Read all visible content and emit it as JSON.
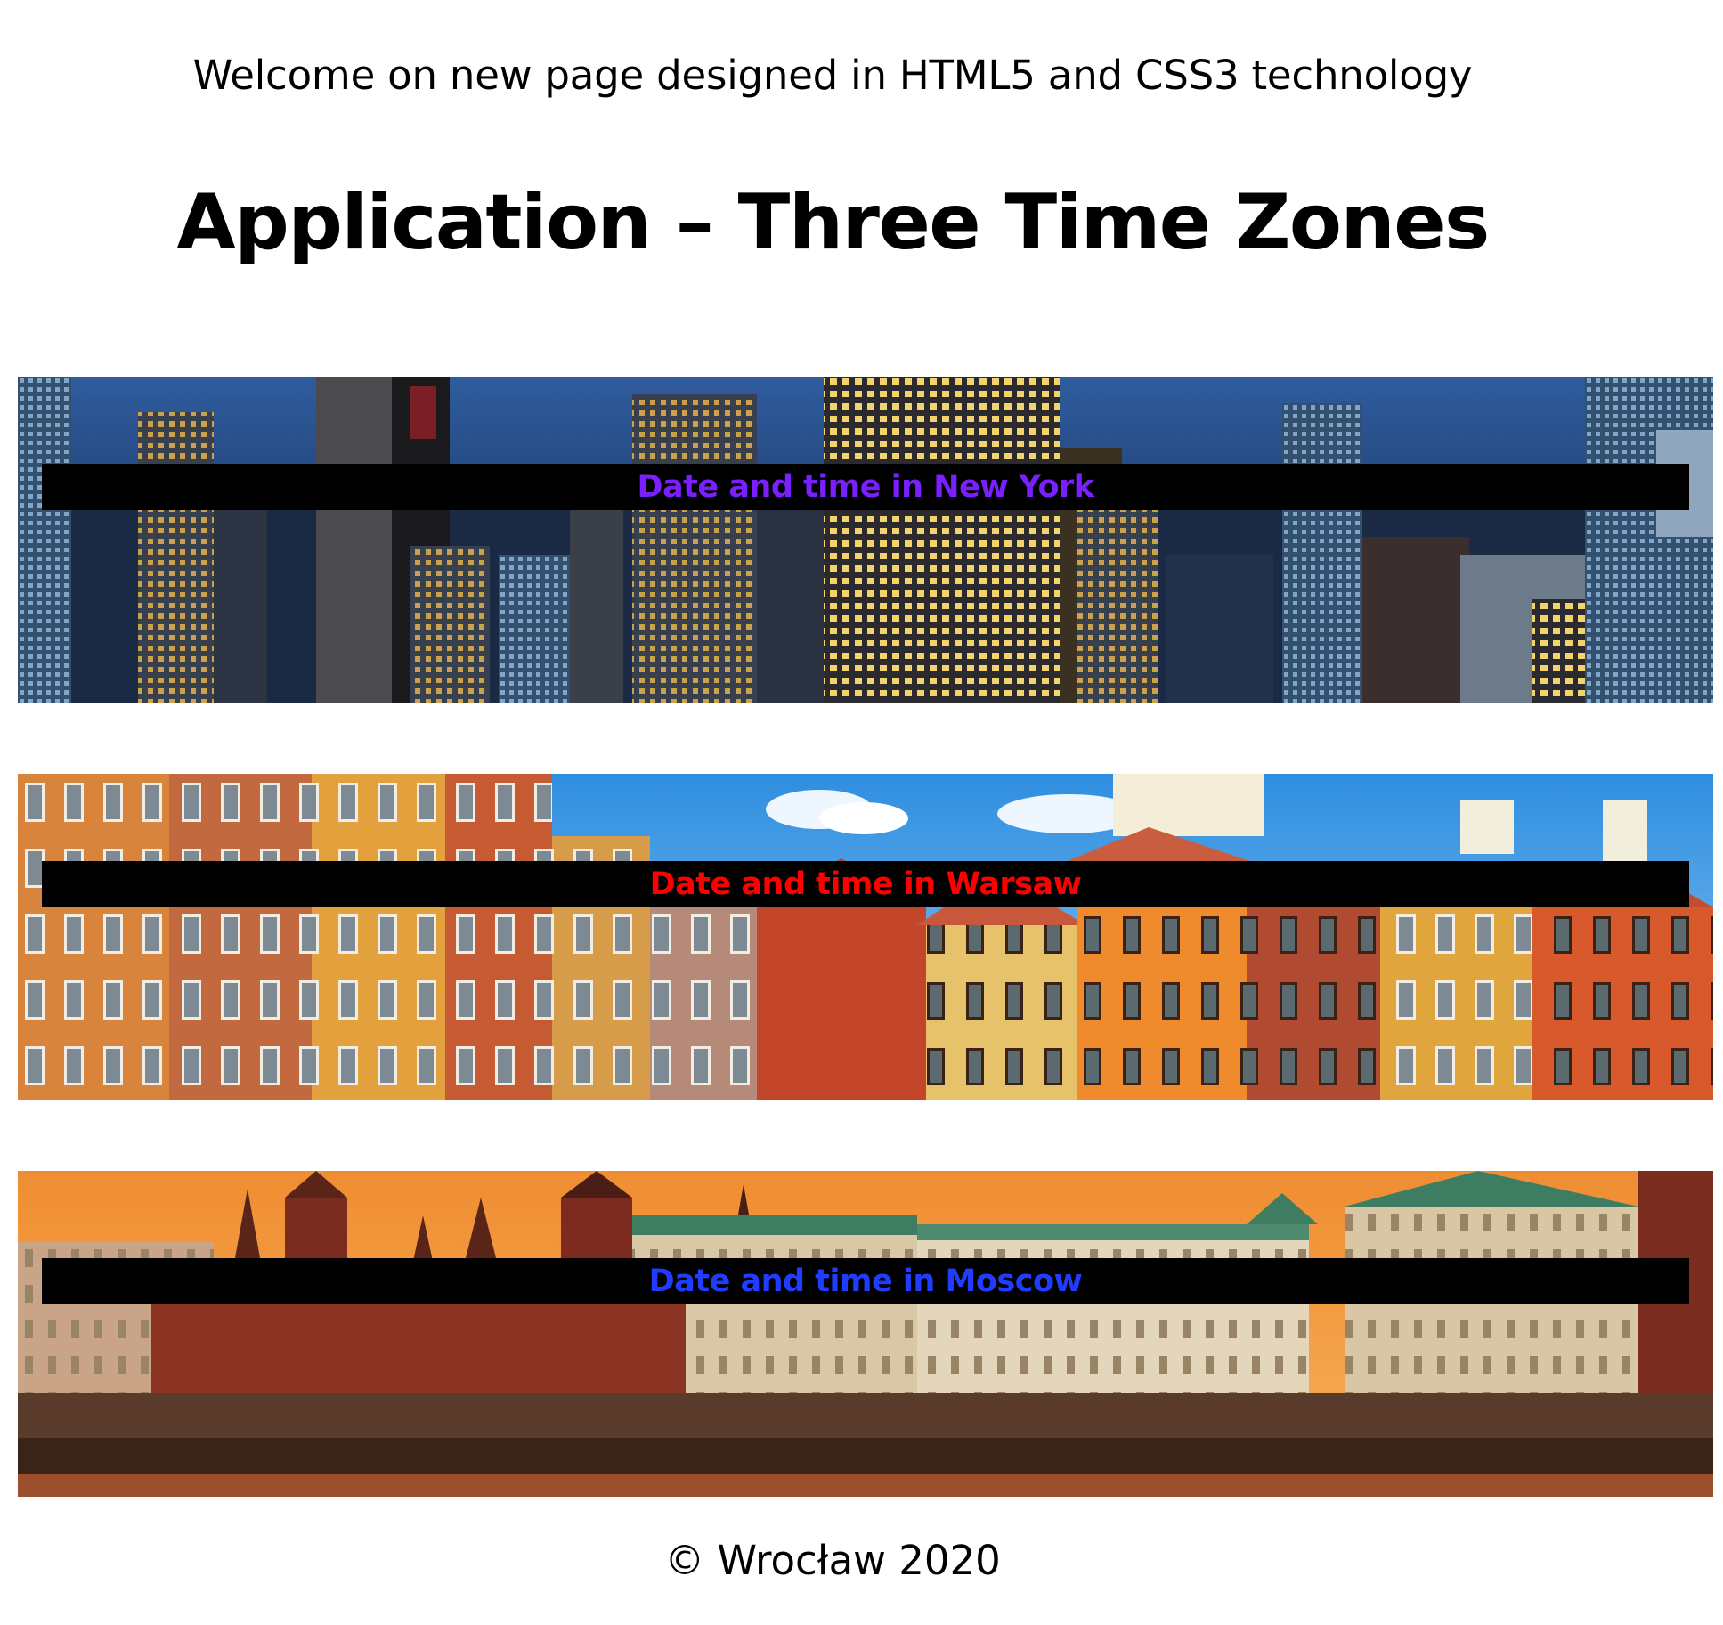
{
  "header": {
    "welcome": "Welcome on new page designed in HTML5 and CSS3 technology",
    "title": "Application – Three Time Zones"
  },
  "zones": [
    {
      "label": "Date and time in New York",
      "label_color": "#7a20ff",
      "scene": "new-york-skyline"
    },
    {
      "label": "Date and time in Warsaw",
      "label_color": "#ff0000",
      "scene": "warsaw-old-town"
    },
    {
      "label": "Date and time in Moscow",
      "label_color": "#1f3cff",
      "scene": "moscow-kremlin"
    }
  ],
  "footer": {
    "copyright": "© Wrocław 2020"
  }
}
